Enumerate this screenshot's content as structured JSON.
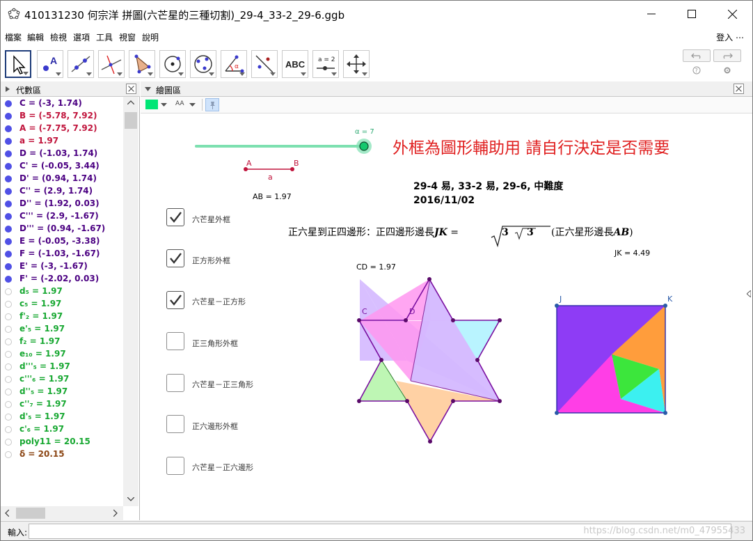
{
  "window": {
    "title": "410131230 何宗洋 拼圖(六芒星的三種切割)_29-4_33-2_29-6.ggb"
  },
  "menu": {
    "items": [
      "檔案",
      "編輯",
      "檢視",
      "選項",
      "工具",
      "視窗",
      "說明"
    ],
    "login": "登入 ⋯"
  },
  "algebra": {
    "title": "代數區",
    "rows": [
      {
        "text": "C = (-3, 1.74)",
        "color": "#4b0082",
        "filled": true
      },
      {
        "text": "B = (-5.78, 7.92)",
        "color": "#c0143c",
        "filled": true
      },
      {
        "text": "A = (-7.75, 7.92)",
        "color": "#c0143c",
        "filled": true
      },
      {
        "text": "a = 1.97",
        "color": "#c0143c",
        "filled": true
      },
      {
        "text": "D = (-1.03, 1.74)",
        "color": "#4b0082",
        "filled": true
      },
      {
        "text": "C' = (-0.05, 3.44)",
        "color": "#4b0082",
        "filled": true
      },
      {
        "text": "D' = (0.94, 1.74)",
        "color": "#4b0082",
        "filled": true
      },
      {
        "text": "C'' = (2.9, 1.74)",
        "color": "#4b0082",
        "filled": true
      },
      {
        "text": "D'' = (1.92, 0.03)",
        "color": "#4b0082",
        "filled": true
      },
      {
        "text": "C''' = (2.9, -1.67)",
        "color": "#4b0082",
        "filled": true
      },
      {
        "text": "D''' = (0.94, -1.67)",
        "color": "#4b0082",
        "filled": true
      },
      {
        "text": "E = (-0.05, -3.38)",
        "color": "#4b0082",
        "filled": true
      },
      {
        "text": "F = (-1.03, -1.67)",
        "color": "#4b0082",
        "filled": true
      },
      {
        "text": "E' = (-3, -1.67)",
        "color": "#4b0082",
        "filled": true
      },
      {
        "text": "F' = (-2.02, 0.03)",
        "color": "#4b0082",
        "filled": true
      },
      {
        "text": "d₅ = 1.97",
        "color": "#18a832",
        "filled": false
      },
      {
        "text": "c₅ = 1.97",
        "color": "#18a832",
        "filled": false
      },
      {
        "text": "f'₂ = 1.97",
        "color": "#18a832",
        "filled": false
      },
      {
        "text": "e'₅ = 1.97",
        "color": "#18a832",
        "filled": false
      },
      {
        "text": "f₂ = 1.97",
        "color": "#18a832",
        "filled": false
      },
      {
        "text": "e₁₀ = 1.97",
        "color": "#18a832",
        "filled": false
      },
      {
        "text": "d'''₅ = 1.97",
        "color": "#18a832",
        "filled": false
      },
      {
        "text": "c'''₆ = 1.97",
        "color": "#18a832",
        "filled": false
      },
      {
        "text": "d''₅ = 1.97",
        "color": "#18a832",
        "filled": false
      },
      {
        "text": "c''₇ = 1.97",
        "color": "#18a832",
        "filled": false
      },
      {
        "text": "d'₅ = 1.97",
        "color": "#18a832",
        "filled": false
      },
      {
        "text": "c'₆ = 1.97",
        "color": "#18a832",
        "filled": false
      },
      {
        "text": "poly11 = 20.15",
        "color": "#18a832",
        "filled": false
      },
      {
        "text": "δ = 20.15",
        "color": "#8b4513",
        "filled": false
      }
    ]
  },
  "graphics": {
    "title": "繪圖區",
    "slider_label": "α = 7",
    "notice": "外框為圖形輔助用 請自行決定是否需要",
    "info_line1": "29-4 易, 33-2 易, 29-6, 中難度",
    "info_line2": "2016/11/02",
    "formula_prefix": "正六星到正四邊形：正四邊形邊長",
    "formula_jk": "JK",
    "formula_eq": " = ",
    "formula_root_outer": "3",
    "formula_root_inner": "3",
    "formula_suffix_open": "(正六星形邊長",
    "formula_ab": "AB",
    "formula_suffix_close": ")",
    "segment_a_label": "A",
    "segment_b_label": "B",
    "segment_name": "a",
    "ab_value": "AB = 1.97",
    "cd_value": "CD = 1.97",
    "jk_value": "JK = 4.49",
    "point_c": "C",
    "point_d": "D",
    "point_j": "J",
    "point_k": "K",
    "checkboxes": [
      {
        "label": "六芒星外框",
        "checked": true
      },
      {
        "label": "正方形外框",
        "checked": true
      },
      {
        "label": "六芒星－正方形",
        "checked": true
      },
      {
        "label": "正三角形外框",
        "checked": false
      },
      {
        "label": "六芒星－正三角形",
        "checked": false
      },
      {
        "label": "正六邊形外框",
        "checked": false
      },
      {
        "label": "六芒星－正六邊形",
        "checked": false
      }
    ]
  },
  "input": {
    "label": "輸入:",
    "value": ""
  },
  "watermark": "https://blog.csdn.net/m0_47955433"
}
